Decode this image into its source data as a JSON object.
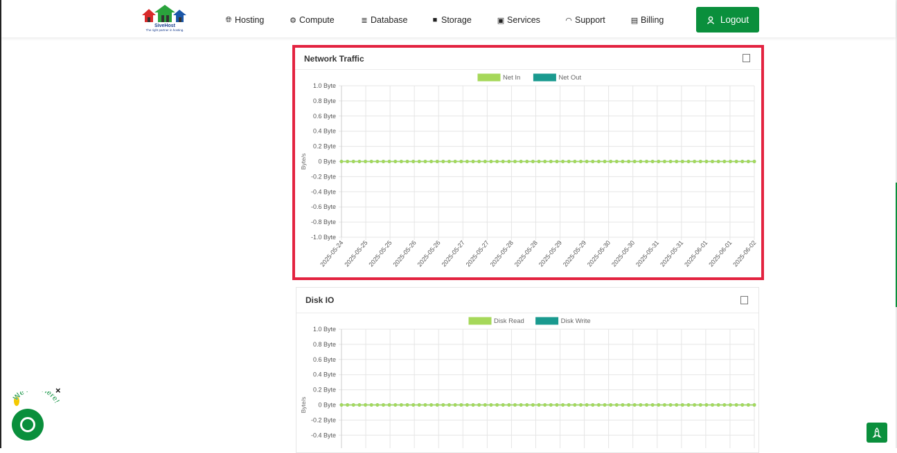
{
  "brand": {
    "name": "SiveHost",
    "tagline": "The right partner in hosting."
  },
  "nav": {
    "items": [
      {
        "label": "Hosting",
        "icon": "globe-icon"
      },
      {
        "label": "Compute",
        "icon": "gear-icon"
      },
      {
        "label": "Database",
        "icon": "database-icon"
      },
      {
        "label": "Storage",
        "icon": "box-icon"
      },
      {
        "label": "Services",
        "icon": "gift-icon"
      },
      {
        "label": "Support",
        "icon": "headset-icon"
      },
      {
        "label": "Billing",
        "icon": "invoice-icon"
      }
    ],
    "logout": "Logout"
  },
  "colors": {
    "accent": "#0a8f3c",
    "highlight": "#e32340",
    "series_in": "#a6d85a",
    "series_out": "#1a9a8f"
  },
  "chat": {
    "label": "We Are Here!",
    "close": "×"
  },
  "chart_data": [
    {
      "type": "line",
      "title": "Network Traffic",
      "ylabel": "Byte/s",
      "ylim": [
        -1.0,
        1.0
      ],
      "y_ticks": [
        "1.0 Byte",
        "0.8 Byte",
        "0.6 Byte",
        "0.4 Byte",
        "0.2 Byte",
        "0 Byte",
        "-0.2 Byte",
        "-0.4 Byte",
        "-0.6 Byte",
        "-0.8 Byte",
        "-1.0 Byte"
      ],
      "x_ticks": [
        "2025-05-24",
        "2025-05-25",
        "2025-05-25",
        "2025-05-26",
        "2025-05-26",
        "2025-05-27",
        "2025-05-27",
        "2025-05-28",
        "2025-05-28",
        "2025-05-29",
        "2025-05-29",
        "2025-05-30",
        "2025-05-30",
        "2025-05-31",
        "2025-05-31",
        "2025-06-01",
        "2025-06-01",
        "2025-06-02"
      ],
      "point_count": 70,
      "grid": true,
      "legend": "top",
      "series": [
        {
          "name": "Net In",
          "value": 0,
          "color": "#a6d85a"
        },
        {
          "name": "Net Out",
          "value": 0,
          "color": "#1a9a8f"
        }
      ]
    },
    {
      "type": "line",
      "title": "Disk IO",
      "ylabel": "Byte/s",
      "ylim": [
        -1.0,
        1.0
      ],
      "y_ticks": [
        "1.0 Byte",
        "0.8 Byte",
        "0.6 Byte",
        "0.4 Byte",
        "0.2 Byte",
        "0 Byte",
        "-0.2 Byte",
        "-0.4 Byte"
      ],
      "x_ticks": [],
      "point_count": 70,
      "grid": true,
      "legend": "top",
      "series": [
        {
          "name": "Disk Read",
          "value": 0,
          "color": "#a6d85a"
        },
        {
          "name": "Disk Write",
          "value": 0,
          "color": "#1a9a8f"
        }
      ]
    }
  ]
}
